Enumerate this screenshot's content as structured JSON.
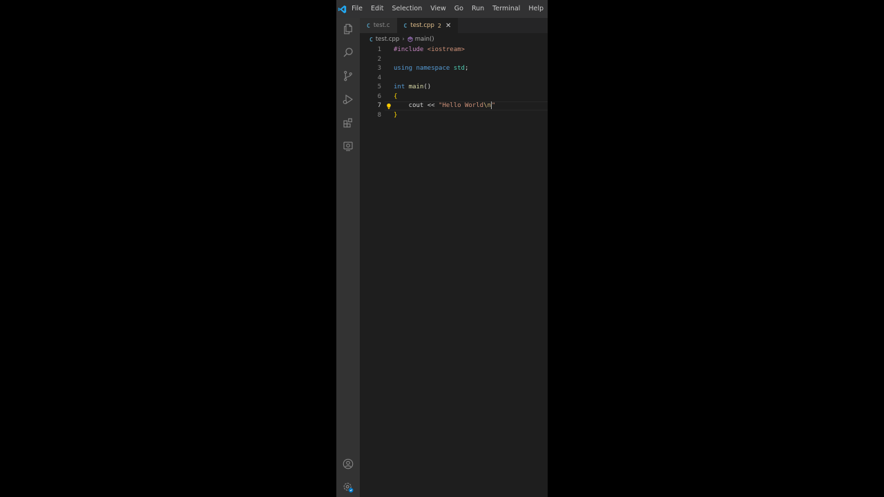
{
  "menu": {
    "items": [
      "File",
      "Edit",
      "Selection",
      "View",
      "Go",
      "Run",
      "Terminal",
      "Help"
    ]
  },
  "activity_bar": {
    "icons": [
      "explorer-icon",
      "search-icon",
      "source-control-icon",
      "run-debug-icon",
      "extensions-icon",
      "remote-explorer-icon",
      "account-icon",
      "manage-gear-icon"
    ]
  },
  "tabs": [
    {
      "label": "test.c",
      "active": false,
      "badge": ""
    },
    {
      "label": "test.cpp",
      "active": true,
      "badge": "2"
    }
  ],
  "breadcrumb": {
    "file": "test.cpp",
    "symbol": "main()"
  },
  "editor": {
    "language": "cpp",
    "current_line": 7,
    "lines": [
      {
        "number": "1",
        "parts": [
          {
            "cls": "kw-dir",
            "text": "#include"
          },
          {
            "cls": "",
            "text": " "
          },
          {
            "cls": "str",
            "text": "<iostream>"
          }
        ]
      },
      {
        "number": "2",
        "parts": []
      },
      {
        "number": "3",
        "parts": [
          {
            "cls": "kw",
            "text": "using"
          },
          {
            "cls": "",
            "text": " "
          },
          {
            "cls": "kw",
            "text": "namespace"
          },
          {
            "cls": "",
            "text": " "
          },
          {
            "cls": "ns",
            "text": "std"
          },
          {
            "cls": "",
            "text": ";"
          }
        ]
      },
      {
        "number": "4",
        "parts": []
      },
      {
        "number": "5",
        "parts": [
          {
            "cls": "kw",
            "text": "int"
          },
          {
            "cls": "",
            "text": " "
          },
          {
            "cls": "fn",
            "text": "main"
          },
          {
            "cls": "",
            "text": "()"
          }
        ]
      },
      {
        "number": "6",
        "parts": [
          {
            "cls": "brace",
            "text": "{"
          }
        ]
      },
      {
        "number": "7",
        "parts": [
          {
            "cls": "",
            "text": "    cout << "
          },
          {
            "cls": "str",
            "text": "\"Hello World"
          },
          {
            "cls": "esc",
            "text": "\\n"
          },
          {
            "cls": "str",
            "text": "\""
          }
        ]
      },
      {
        "number": "8",
        "parts": [
          {
            "cls": "brace",
            "text": "}"
          }
        ]
      }
    ]
  },
  "colors": {
    "editor_bg": "#1e1e1e",
    "titlebar_bg": "#323233",
    "activitybar_bg": "#333333",
    "accent_blue": "#007acc",
    "modified_tab": "#e2c08d"
  }
}
